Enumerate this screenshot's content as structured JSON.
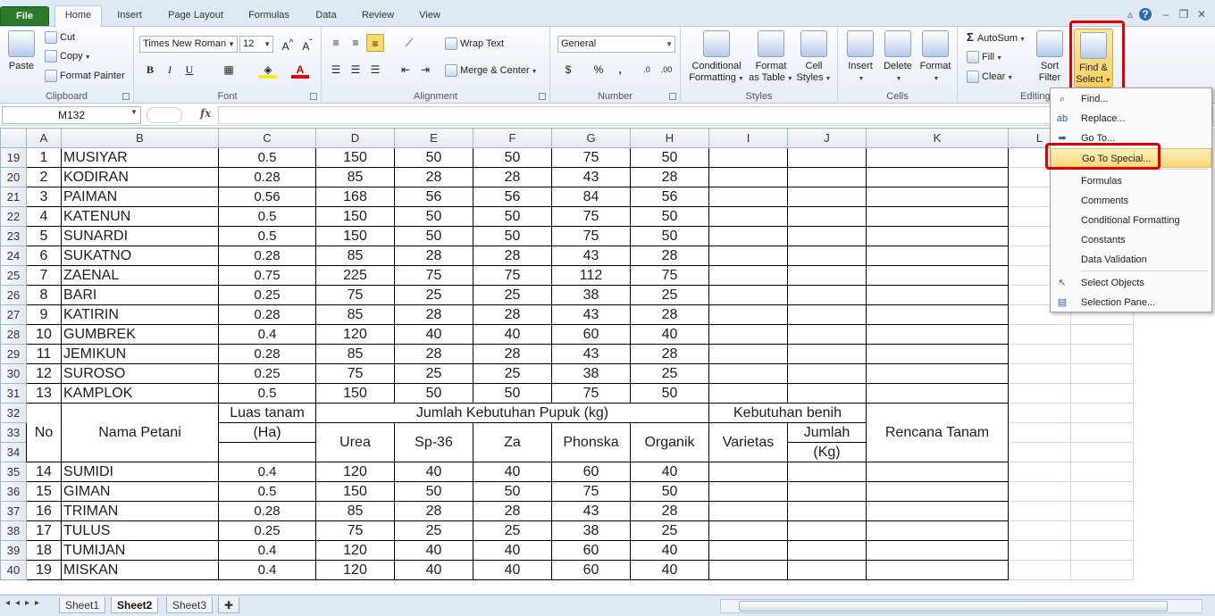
{
  "tabs": [
    "File",
    "Home",
    "Insert",
    "Page Layout",
    "Formulas",
    "Data",
    "Review",
    "View"
  ],
  "ribbon": {
    "clipboard": {
      "paste": "Paste",
      "cut": "Cut",
      "copy": "Copy",
      "format_painter": "Format Painter",
      "label": "Clipboard"
    },
    "font": {
      "name": "Times New Roman",
      "size": "12",
      "bold": "B",
      "italic": "I",
      "underline": "U",
      "label": "Font"
    },
    "alignment": {
      "wrap": "Wrap Text",
      "merge": "Merge & Center",
      "label": "Alignment"
    },
    "number": {
      "format": "General",
      "currency": "$",
      "percent": "%",
      "comma": ",",
      "label": "Number"
    },
    "styles": {
      "cond1": "Conditional",
      "cond2": "Formatting",
      "fmt1": "Format",
      "fmt2": "as Table",
      "cell1": "Cell",
      "cell2": "Styles",
      "label": "Styles"
    },
    "cells": {
      "insert": "Insert",
      "delete": "Delete",
      "format": "Format",
      "label": "Cells"
    },
    "editing": {
      "autosum": "AutoSum",
      "fill": "Fill",
      "clear": "Clear",
      "sort1": "Sort",
      "sort2": "Filter",
      "find1": "Find &",
      "find2": "Select",
      "label": "Editing"
    }
  },
  "formula_bar": {
    "name_box": "M132",
    "fx": "fx",
    "value": ""
  },
  "columns": [
    "A",
    "B",
    "C",
    "D",
    "E",
    "F",
    "G",
    "H",
    "I",
    "J",
    "K",
    "L"
  ],
  "rows": [
    {
      "r": "19",
      "no": "1",
      "name": "MUSIYAR",
      "c": "0.5",
      "d": "150",
      "e": "50",
      "f": "50",
      "g": "75",
      "h": "50"
    },
    {
      "r": "20",
      "no": "2",
      "name": "KODIRAN",
      "c": "0.28",
      "d": "85",
      "e": "28",
      "f": "28",
      "g": "43",
      "h": "28"
    },
    {
      "r": "21",
      "no": "3",
      "name": "PAIMAN",
      "c": "0.56",
      "d": "168",
      "e": "56",
      "f": "56",
      "g": "84",
      "h": "56"
    },
    {
      "r": "22",
      "no": "4",
      "name": "KATENUN",
      "c": "0.5",
      "d": "150",
      "e": "50",
      "f": "50",
      "g": "75",
      "h": "50"
    },
    {
      "r": "23",
      "no": "5",
      "name": "SUNARDI",
      "c": "0.5",
      "d": "150",
      "e": "50",
      "f": "50",
      "g": "75",
      "h": "50"
    },
    {
      "r": "24",
      "no": "6",
      "name": "SUKATNO",
      "c": "0.28",
      "d": "85",
      "e": "28",
      "f": "28",
      "g": "43",
      "h": "28"
    },
    {
      "r": "25",
      "no": "7",
      "name": "ZAENAL",
      "c": "0.75",
      "d": "225",
      "e": "75",
      "f": "75",
      "g": "112",
      "h": "75"
    },
    {
      "r": "26",
      "no": "8",
      "name": "BARI",
      "c": "0.25",
      "d": "75",
      "e": "25",
      "f": "25",
      "g": "38",
      "h": "25"
    },
    {
      "r": "27",
      "no": "9",
      "name": "KATIRIN",
      "c": "0.28",
      "d": "85",
      "e": "28",
      "f": "28",
      "g": "43",
      "h": "28"
    },
    {
      "r": "28",
      "no": "10",
      "name": "GUMBREK",
      "c": "0.4",
      "d": "120",
      "e": "40",
      "f": "40",
      "g": "60",
      "h": "40"
    },
    {
      "r": "29",
      "no": "11",
      "name": "JEMIKUN",
      "c": "0.28",
      "d": "85",
      "e": "28",
      "f": "28",
      "g": "43",
      "h": "28"
    },
    {
      "r": "30",
      "no": "12",
      "name": "SUROSO",
      "c": "0.25",
      "d": "75",
      "e": "25",
      "f": "25",
      "g": "38",
      "h": "25"
    },
    {
      "r": "31",
      "no": "13",
      "name": "KAMPLOK",
      "c": "0.5",
      "d": "150",
      "e": "50",
      "f": "50",
      "g": "75",
      "h": "50"
    }
  ],
  "header_block": {
    "rows": [
      "32",
      "33",
      "34"
    ],
    "no": "No",
    "nama": "Nama Petani",
    "luas1": "Luas tanam",
    "luas2": "(Ha)",
    "pupuk": "Jumlah Kebutuhan Pupuk (kg)",
    "urea": "Urea",
    "sp36": "Sp-36",
    "za": "Za",
    "phonska": "Phonska",
    "organik": "Organik",
    "benih": "Kebutuhan benih",
    "varietas": "Varietas",
    "jumlah1": "Jumlah",
    "jumlah2": "(Kg)",
    "rencana": "Rencana Tanam"
  },
  "rows2": [
    {
      "r": "35",
      "no": "14",
      "name": "SUMIDI",
      "c": "0.4",
      "d": "120",
      "e": "40",
      "f": "40",
      "g": "60",
      "h": "40"
    },
    {
      "r": "36",
      "no": "15",
      "name": "GIMAN",
      "c": "0.5",
      "d": "150",
      "e": "50",
      "f": "50",
      "g": "75",
      "h": "50"
    },
    {
      "r": "37",
      "no": "16",
      "name": "TRIMAN",
      "c": "0.28",
      "d": "85",
      "e": "28",
      "f": "28",
      "g": "43",
      "h": "28"
    },
    {
      "r": "38",
      "no": "17",
      "name": "TULUS",
      "c": "0.25",
      "d": "75",
      "e": "25",
      "f": "25",
      "g": "38",
      "h": "25"
    },
    {
      "r": "39",
      "no": "18",
      "name": "TUMIJAN",
      "c": "0.4",
      "d": "120",
      "e": "40",
      "f": "40",
      "g": "60",
      "h": "40"
    },
    {
      "r": "40",
      "no": "19",
      "name": "MISKAN",
      "c": "0.4",
      "d": "120",
      "e": "40",
      "f": "40",
      "g": "60",
      "h": "40"
    }
  ],
  "sheets": [
    "Sheet1",
    "Sheet2",
    "Sheet3"
  ],
  "active_sheet": "Sheet2",
  "menu": {
    "find": "Find...",
    "replace": "Replace...",
    "goto": "Go To...",
    "goto_special": "Go To Special...",
    "formulas": "Formulas",
    "comments": "Comments",
    "cond_fmt": "Conditional Formatting",
    "constants": "Constants",
    "data_val": "Data Validation",
    "select_objects": "Select Objects",
    "selection_pane": "Selection Pane..."
  },
  "colors": {
    "accent": "#2a7a2c",
    "highlight": "#e00000",
    "menu_hover": "#f8d875"
  }
}
